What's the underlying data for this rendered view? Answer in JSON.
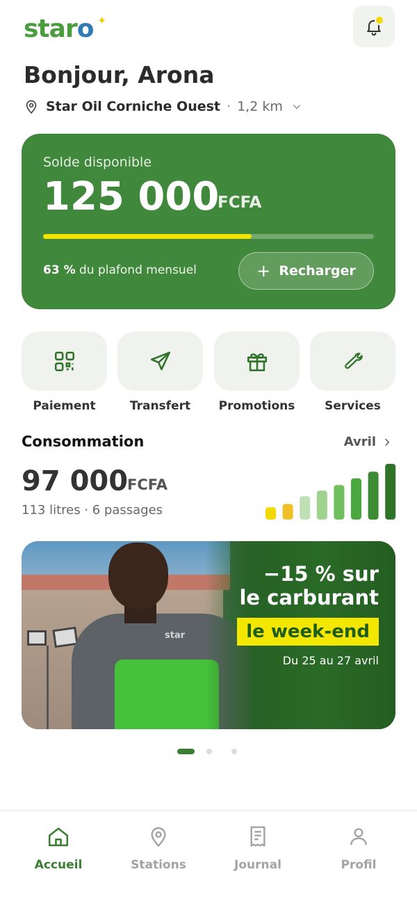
{
  "header": {
    "logo_text": "star",
    "logo_o": "o",
    "greeting": "Bonjour, Arona",
    "station_name": "Star Oil Corniche Ouest",
    "separator": "·",
    "station_distance": "1,2 km"
  },
  "balance": {
    "label": "Solde disponible",
    "amount": "125 000",
    "currency": "FCFA",
    "progress_fraction": 0.63,
    "limit_percent": "63 %",
    "limit_text": "du plafond mensuel",
    "recharge_label": "Recharger"
  },
  "actions": [
    {
      "label": "Paiement",
      "icon": "qr-code-icon"
    },
    {
      "label": "Transfert",
      "icon": "send-icon"
    },
    {
      "label": "Promotions",
      "icon": "gift-icon"
    },
    {
      "label": "Services",
      "icon": "wrench-icon"
    }
  ],
  "consumption": {
    "title": "Consommation",
    "month": "Avril",
    "amount": "97 000",
    "currency": "FCFA",
    "details": "113 litres · 6 passages",
    "bars": [
      0.22,
      0.28,
      0.42,
      0.52,
      0.62,
      0.74,
      0.86,
      1.0
    ],
    "bar_colors": [
      "#f3d900",
      "#f0c02a",
      "#bfe0b4",
      "#9fd18f",
      "#6fbf5f",
      "#4aa83e",
      "#3d8c35",
      "#2f7329"
    ]
  },
  "promo": {
    "line1": "−15 % sur",
    "line2": "le carburant",
    "highlight": "le week-end",
    "dates": "Du 25 au 27 avril",
    "shirt_logo": "star",
    "slides": 3,
    "active_slide": 0
  },
  "tabs": [
    {
      "label": "Accueil",
      "icon": "home-icon",
      "active": true
    },
    {
      "label": "Stations",
      "icon": "map-pin-icon",
      "active": false
    },
    {
      "label": "Journal",
      "icon": "receipt-icon",
      "active": false
    },
    {
      "label": "Profil",
      "icon": "user-icon",
      "active": false
    }
  ],
  "colors": {
    "brand_green": "#40883b",
    "accent_yellow": "#f3e400",
    "tab_active": "#3a7d33"
  }
}
